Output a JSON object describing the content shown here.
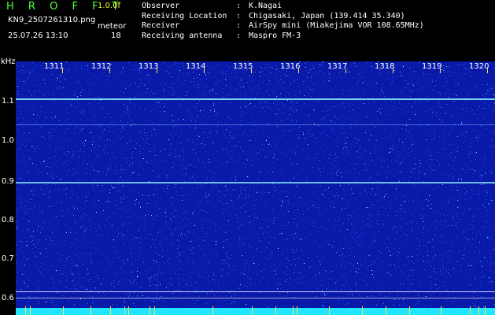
{
  "header": {
    "brand": "H R O F F T",
    "version": "1.0.0f",
    "filename": "KN9_2507261310.png",
    "timestamp": "25.07.26 13:10",
    "count_label": "meteor",
    "count_value": "18"
  },
  "info": [
    {
      "key": "Observer",
      "sep": ":",
      "value": "K.Nagai"
    },
    {
      "key": "Receiving Location",
      "sep": ":",
      "value": "Chigasaki, Japan (139.414 35.340)"
    },
    {
      "key": "Receiver",
      "sep": ":",
      "value": "AirSpy mini (Miakejima VOR 108.65MHz)"
    },
    {
      "key": "Receiving antenna",
      "sep": ":",
      "value": "Maspro FM-3"
    }
  ],
  "axis": {
    "y_unit": "kHz",
    "y_ticks": [
      "1.1",
      "1.0",
      "0.9",
      "0.8",
      "0.7",
      "0.6"
    ],
    "x_ticks": [
      "1311",
      "1312",
      "1313",
      "1314",
      "1315",
      "1316",
      "1317",
      "1318",
      "1319",
      "1320"
    ]
  },
  "colors": {
    "background": "#0a1aa8",
    "trace": "#8cf6ff",
    "brand": "#4cff3c",
    "version": "#e8ff3a"
  }
}
